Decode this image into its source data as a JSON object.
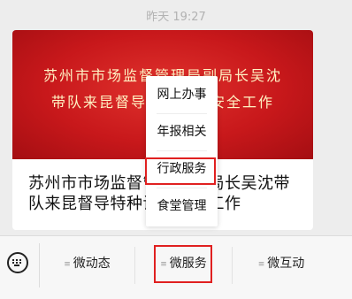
{
  "chat": {
    "timestamp": "昨天 19:27"
  },
  "article": {
    "banner_line1": "苏州市市场监督管理局副局长吴沈",
    "banner_line2": "带队来昆督导特种设备安全工作",
    "title": "苏州市市场监督管理局副局长吴沈带队来昆督导特种设备安全工作"
  },
  "submenu": {
    "items": [
      {
        "label": "网上办事"
      },
      {
        "label": "年报相关"
      },
      {
        "label": "行政服务",
        "highlighted": true
      },
      {
        "label": "食堂管理"
      }
    ]
  },
  "menubar": {
    "keyboard_icon": "keyboard-icon",
    "tabs": [
      {
        "label": "微动态",
        "icon": "menu-lines-icon"
      },
      {
        "label": "微服务",
        "icon": "menu-lines-icon",
        "highlighted": true
      },
      {
        "label": "微互动",
        "icon": "menu-lines-icon"
      }
    ]
  },
  "colors": {
    "highlight_border": "#e02020",
    "banner_red": "#c8181b",
    "banner_text": "#fff3c4"
  }
}
